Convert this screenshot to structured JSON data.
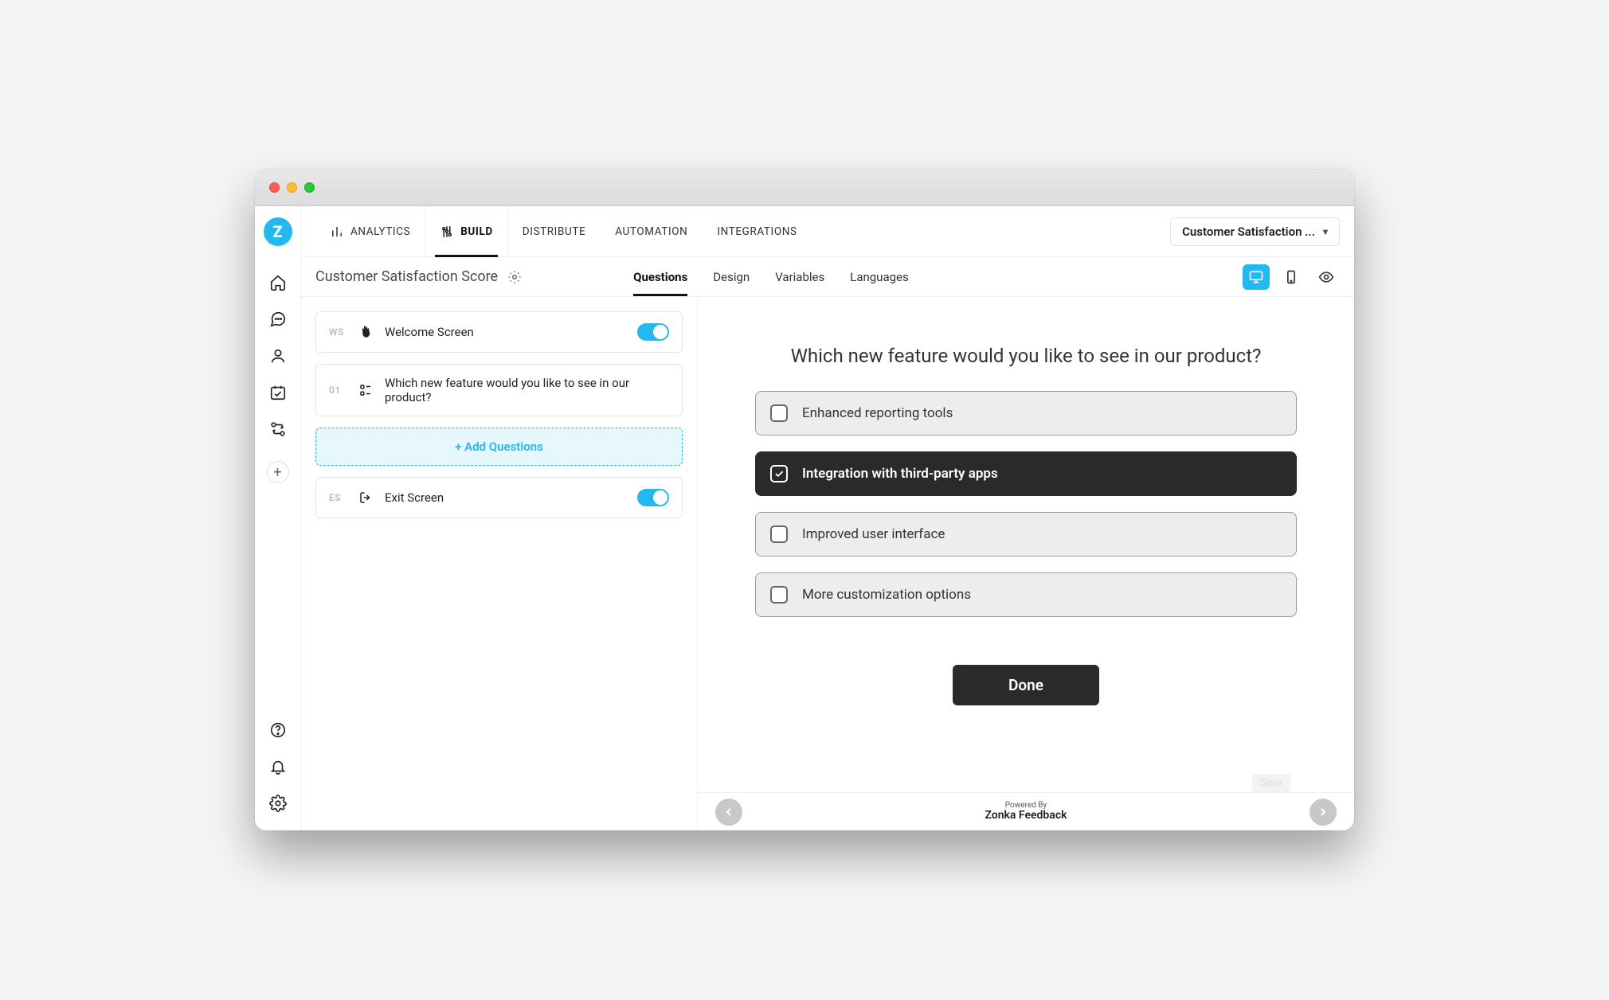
{
  "topnav": {
    "items": [
      {
        "label": "ANALYTICS",
        "active": false
      },
      {
        "label": "BUILD",
        "active": true
      },
      {
        "label": "DISTRIBUTE",
        "active": false
      },
      {
        "label": "AUTOMATION",
        "active": false
      },
      {
        "label": "INTEGRATIONS",
        "active": false
      }
    ]
  },
  "survey_selector": "Customer Satisfaction ...",
  "survey_title": "Customer Satisfaction Score",
  "subtabs": {
    "items": [
      {
        "label": "Questions",
        "active": true
      },
      {
        "label": "Design",
        "active": false
      },
      {
        "label": "Variables",
        "active": false
      },
      {
        "label": "Languages",
        "active": false
      }
    ]
  },
  "builder": {
    "welcome": {
      "prefix": "WS",
      "label": "Welcome Screen",
      "toggled": true
    },
    "q1": {
      "prefix": "01",
      "label": "Which new feature would you like to see in our product?"
    },
    "add": "+ Add Questions",
    "exit": {
      "prefix": "ES",
      "label": "Exit Screen",
      "toggled": true
    }
  },
  "preview": {
    "question": "Which new feature would you like to see in our product?",
    "options": [
      {
        "label": "Enhanced reporting tools",
        "selected": false
      },
      {
        "label": "Integration with third-party apps",
        "selected": true
      },
      {
        "label": "Improved user interface",
        "selected": false
      },
      {
        "label": "More customization options",
        "selected": false
      }
    ],
    "done": "Done",
    "save": "Save",
    "powered_prefix": "Powered By",
    "powered_brand": "Zonka Feedback"
  },
  "logo_letter": "Z"
}
